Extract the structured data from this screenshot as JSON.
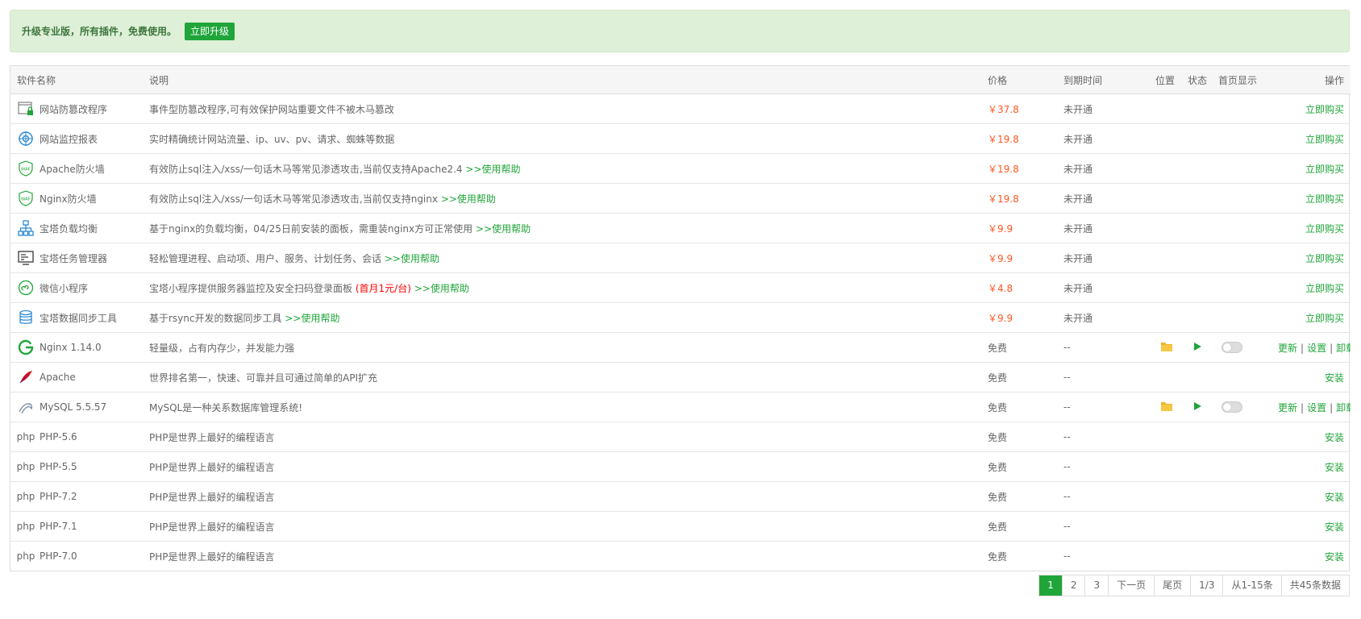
{
  "banner": {
    "message": "升级专业版，所有插件，免费使用。",
    "button": "立即升级"
  },
  "columns": {
    "name": "软件名称",
    "desc": "说明",
    "price": "价格",
    "expire": "到期时间",
    "location": "位置",
    "status": "状态",
    "home": "首页显示",
    "ops": "操作"
  },
  "rows": [
    {
      "icon": "tamper-proof-icon",
      "name": "网站防篡改程序",
      "desc": "事件型防篡改程序,可有效保护网站重要文件不被木马篡改",
      "help": "",
      "price": "￥37.8",
      "expire": "未开通",
      "action": "立即购买"
    },
    {
      "icon": "monitor-report-icon",
      "name": "网站监控报表",
      "desc": "实时精确统计网站流量、ip、uv、pv、请求、蜘蛛等数据",
      "help": "",
      "price": "￥19.8",
      "expire": "未开通",
      "action": "立即购买"
    },
    {
      "icon": "waf-shield-icon",
      "name": "Apache防火墙",
      "desc": "有效防止sql注入/xss/一句话木马等常见渗透攻击,当前仅支持Apache2.4",
      "help": ">>使用帮助",
      "price": "￥19.8",
      "expire": "未开通",
      "action": "立即购买"
    },
    {
      "icon": "waf-shield-icon",
      "name": "Nginx防火墙",
      "desc": "有效防止sql注入/xss/一句话木马等常见渗透攻击,当前仅支持nginx",
      "help": ">>使用帮助",
      "price": "￥19.8",
      "expire": "未开通",
      "action": "立即购买"
    },
    {
      "icon": "load-balance-icon",
      "name": "宝塔负载均衡",
      "desc": "基于nginx的负载均衡，04/25日前安装的面板，需重装nginx方可正常使用",
      "help": ">>使用帮助",
      "price": "￥9.9",
      "expire": "未开通",
      "action": "立即购买"
    },
    {
      "icon": "task-manager-icon",
      "name": "宝塔任务管理器",
      "desc": "轻松管理进程、启动项、用户、服务、计划任务、会话",
      "help": ">>使用帮助",
      "price": "￥9.9",
      "expire": "未开通",
      "action": "立即购买"
    },
    {
      "icon": "mini-program-icon",
      "name": "微信小程序",
      "desc": "宝塔小程序提供服务器监控及安全扫码登录面板",
      "promo": "(首月1元/台)",
      "help": ">>使用帮助",
      "price": "￥4.8",
      "expire": "未开通",
      "action": "立即购买"
    },
    {
      "icon": "database-sync-icon",
      "name": "宝塔数据同步工具",
      "desc": "基于rsync开发的数据同步工具",
      "help": ">>使用帮助",
      "price": "￥9.9",
      "expire": "未开通",
      "action": "立即购买"
    },
    {
      "icon": "nginx-logo-icon",
      "name": "Nginx 1.14.0",
      "desc": "轻量级，占有内存少，并发能力强",
      "help": "",
      "price": "免费",
      "expire": "--",
      "installed": true,
      "ops": [
        "更新",
        "设置",
        "卸载"
      ]
    },
    {
      "icon": "apache-feather-icon",
      "name": "Apache",
      "desc": "世界排名第一，快速、可靠并且可通过简单的API扩充",
      "help": "",
      "price": "免费",
      "expire": "--",
      "action": "安装"
    },
    {
      "icon": "mysql-dolphin-icon",
      "name": "MySQL 5.5.57",
      "desc": "MySQL是一种关系数据库管理系统!",
      "help": "",
      "price": "免费",
      "expire": "--",
      "installed": true,
      "ops": [
        "更新",
        "设置",
        "卸载"
      ]
    },
    {
      "icon": "php-logo-icon",
      "name": "PHP-5.6",
      "desc": "PHP是世界上最好的编程语言",
      "help": "",
      "price": "免费",
      "expire": "--",
      "action": "安装"
    },
    {
      "icon": "php-logo-icon",
      "name": "PHP-5.5",
      "desc": "PHP是世界上最好的编程语言",
      "help": "",
      "price": "免费",
      "expire": "--",
      "action": "安装"
    },
    {
      "icon": "php-logo-icon",
      "name": "PHP-7.2",
      "desc": "PHP是世界上最好的编程语言",
      "help": "",
      "price": "免费",
      "expire": "--",
      "action": "安装"
    },
    {
      "icon": "php-logo-icon",
      "name": "PHP-7.1",
      "desc": "PHP是世界上最好的编程语言",
      "help": "",
      "price": "免费",
      "expire": "--",
      "action": "安装"
    },
    {
      "icon": "php-logo-icon",
      "name": "PHP-7.0",
      "desc": "PHP是世界上最好的编程语言",
      "help": "",
      "price": "免费",
      "expire": "--",
      "action": "安装"
    }
  ],
  "php_label": "php",
  "pagination": {
    "pages": [
      "1",
      "2",
      "3"
    ],
    "current": "1",
    "next": "下一页",
    "last": "尾页",
    "page_of": "1/3",
    "range": "从1-15条",
    "total": "共45条数据"
  },
  "colors": {
    "accent": "#20a53a",
    "price": "#ff5722",
    "promo": "#ff0000",
    "banner_bg": "#dff0d8",
    "banner_text": "#3c763d"
  }
}
